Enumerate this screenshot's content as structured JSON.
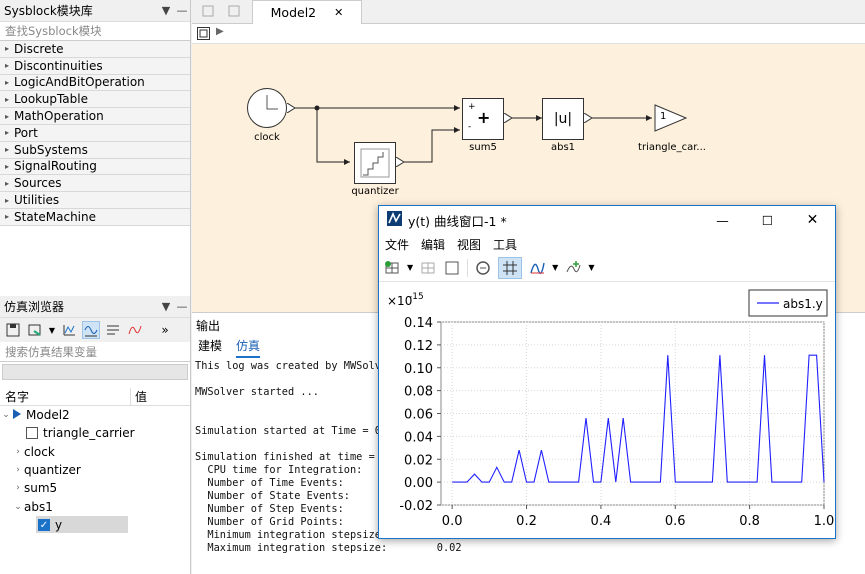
{
  "library": {
    "title": "Sysblock模块库",
    "search_placeholder": "查找Sysblock模块",
    "items": [
      "Discrete",
      "Discontinuities",
      "LogicAndBitOperation",
      "LookupTable",
      "MathOperation",
      "Port",
      "SubSystems",
      "SignalRouting",
      "Sources",
      "Utilities",
      "StateMachine"
    ]
  },
  "sim_browser": {
    "title": "仿真浏览器",
    "search_placeholder": "搜索仿真结果变量",
    "col_name": "名字",
    "col_value": "值",
    "tree": {
      "model": "Model2",
      "children": [
        "triangle_carrier",
        "clock",
        "quantizer",
        "sum5",
        "abs1"
      ],
      "leaf": "y"
    }
  },
  "editor": {
    "tab_label": "Model2",
    "blocks": {
      "clock": "clock",
      "quantizer": "quantizer",
      "sum": "sum5",
      "sum_symbol": "+",
      "sum_plus": "+",
      "sum_minus": "-",
      "abs": "abs1",
      "abs_symbol": "|u|",
      "out": "triangle_car...",
      "out_port": "1"
    }
  },
  "output": {
    "title": "输出",
    "tabs": [
      "建模",
      "仿真"
    ],
    "active_tab": "仿真",
    "log": [
      "This log was created by MWSolv",
      "",
      "MWSolver started ...",
      "",
      "",
      "Simulation started at Time = 0",
      "",
      "Simulation finished at time =",
      "  CPU time for Integration:",
      "  Number of Time Events:",
      "  Number of State Events:",
      "  Number of Step Events:",
      "  Number of Grid Points:",
      "  Minimum integration stepsize:",
      "  Maximum integration stepsize:        0.02"
    ]
  },
  "plot_window": {
    "title": "y(t) 曲线窗口-1 *",
    "menu": [
      "文件",
      "编辑",
      "视图",
      "工具"
    ],
    "exponent": "×10",
    "exponent_power": "-15"
  },
  "chart_data": {
    "type": "line",
    "series": [
      {
        "name": "abs1.y",
        "color": "#2020ff"
      }
    ],
    "x": [
      0,
      0.04,
      0.06,
      0.08,
      0.1,
      0.12,
      0.14,
      0.16,
      0.18,
      0.2,
      0.22,
      0.24,
      0.26,
      0.34,
      0.36,
      0.38,
      0.4,
      0.42,
      0.44,
      0.46,
      0.48,
      0.5,
      0.56,
      0.58,
      0.6,
      0.7,
      0.72,
      0.74,
      0.82,
      0.84,
      0.86,
      0.94,
      0.96,
      0.98,
      1.0
    ],
    "y": [
      0,
      0,
      0.007,
      0,
      0,
      0.013,
      0,
      0,
      0.028,
      0,
      0,
      0.028,
      0,
      0,
      0.056,
      0,
      0,
      0.056,
      0,
      0.056,
      0,
      0,
      0,
      0.111,
      0,
      0,
      0.111,
      0,
      0,
      0.111,
      0,
      0,
      0.111,
      0.111,
      0
    ],
    "xlim": [
      -0.03,
      1.0
    ],
    "ylim": [
      -0.02,
      0.14
    ],
    "xticks": [
      "0.0",
      "0.2",
      "0.4",
      "0.6",
      "0.8",
      "1.0"
    ],
    "yticks": [
      "-0.02",
      "0.00",
      "0.02",
      "0.04",
      "0.06",
      "0.08",
      "0.10",
      "0.12",
      "0.14"
    ],
    "grid": true,
    "legend": "top-right"
  }
}
